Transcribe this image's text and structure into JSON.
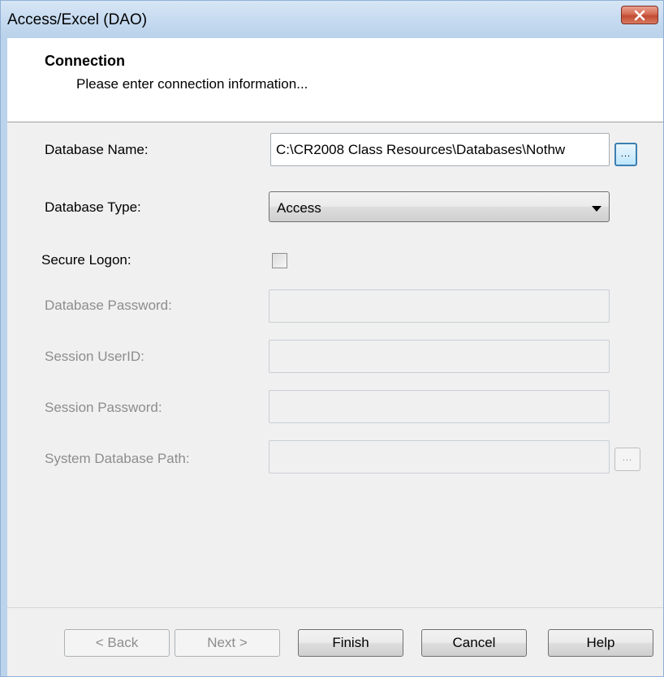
{
  "window": {
    "title": "Access/Excel (DAO)",
    "close_icon": "close-x-icon"
  },
  "header": {
    "title": "Connection",
    "subtitle": "Please enter connection information..."
  },
  "form": {
    "database_name": {
      "label": "Database Name:",
      "value": "C:\\CR2008 Class Resources\\Databases\\Nothw",
      "browse_label": "..."
    },
    "database_type": {
      "label": "Database Type:",
      "selected": "Access"
    },
    "secure_logon": {
      "label": "Secure Logon:",
      "checked": false
    },
    "database_password": {
      "label": "Database Password:",
      "value": ""
    },
    "session_userid": {
      "label": "Session UserID:",
      "value": ""
    },
    "session_password": {
      "label": "Session Password:",
      "value": ""
    },
    "system_database_path": {
      "label": "System Database Path:",
      "value": "",
      "browse_label": "..."
    }
  },
  "buttons": {
    "back": "< Back",
    "next": "Next >",
    "finish": "Finish",
    "cancel": "Cancel",
    "help": "Help"
  },
  "colors": {
    "title_bar": "#c5daf0",
    "close_button": "#c94f37",
    "dialog_body": "#f0f0f0",
    "disabled_text": "#8d8d8d",
    "browse_active_border": "#3c7fb1"
  }
}
